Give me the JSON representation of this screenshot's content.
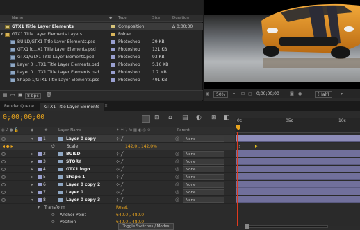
{
  "project": {
    "headers": {
      "name": "Name",
      "type": "Type",
      "size": "Size",
      "duration": "Duration"
    },
    "items": [
      {
        "name": "GTX1 Title Layer Elements",
        "type": "Composition",
        "size": "",
        "duration": "Δ 0;00;30",
        "label_color": "#d6c37a",
        "icon": "composition-icon",
        "selected": true
      },
      {
        "name": "GTX1 Title Layer Elements Layers",
        "type": "Folder",
        "size": "",
        "duration": "",
        "label_color": "#d8b55c",
        "icon": "folder-icon"
      },
      {
        "name": "BUILD/GTX1 Title Layer Elements.psd",
        "type": "Photoshop",
        "size": "29 KB",
        "duration": "",
        "label_color": "#9aa0d0",
        "icon": "photoshop-file-icon"
      },
      {
        "name": "GTX1 lo...X1 Title Layer Elements.psd",
        "type": "Photoshop",
        "size": "121 KB",
        "duration": "",
        "label_color": "#9aa0d0",
        "icon": "photoshop-file-icon"
      },
      {
        "name": "GTX1/GTX1 Title Layer Elements.psd",
        "type": "Photoshop",
        "size": "93 KB",
        "duration": "",
        "label_color": "#9aa0d0",
        "icon": "photoshop-file-icon"
      },
      {
        "name": "Layer 0 ...TX1 Title Layer Elements.psd",
        "type": "Photoshop",
        "size": "5.16 KB",
        "duration": "",
        "label_color": "#9aa0d0",
        "icon": "photoshop-file-icon"
      },
      {
        "name": "Layer 0 ...TX1 Title Layer Elements.psd",
        "type": "Photoshop",
        "size": "1.7 MB",
        "duration": "",
        "label_color": "#9aa0d0",
        "icon": "photoshop-file-icon"
      },
      {
        "name": "Shape 1/GTX1 Title Layer Elements.psd",
        "type": "Photoshop",
        "size": "491 KB",
        "duration": "",
        "label_color": "#9aa0d0",
        "icon": "photoshop-file-icon"
      }
    ],
    "bpc": "8 bpc"
  },
  "viewer": {
    "zoom": "50%",
    "timecode": "0;00;00;00",
    "quality": "(Half)"
  },
  "tabs": [
    {
      "label": "Render Queue",
      "active": false
    },
    {
      "label": "GTX1 Title Layer Elements",
      "active": true
    }
  ],
  "timeline": {
    "timecode": "0;00;00;00",
    "headers": {
      "num": "#",
      "layer_name": "Layer Name",
      "parent": "Parent"
    },
    "ruler": [
      "0s",
      "05s",
      "10s"
    ],
    "layers": [
      {
        "num": "1",
        "name": "Layer 0 copy",
        "label_color": "#9aa0d0",
        "parent": "None",
        "selected": true
      },
      {
        "num": "2",
        "name": "BUILD",
        "label_color": "#9aa0d0",
        "parent": "None"
      },
      {
        "num": "3",
        "name": "STORY",
        "label_color": "#9aa0d0",
        "parent": "None"
      },
      {
        "num": "4",
        "name": "GTX1 logo",
        "label_color": "#9aa0d0",
        "parent": "None"
      },
      {
        "num": "5",
        "name": "Shape 1",
        "label_color": "#9aa0d0",
        "parent": "None"
      },
      {
        "num": "6",
        "name": "Layer 0 copy 2",
        "label_color": "#9aa0d0",
        "parent": "None"
      },
      {
        "num": "7",
        "name": "Layer 0",
        "label_color": "#9aa0d0",
        "parent": "None"
      },
      {
        "num": "8",
        "name": "Layer 0 copy 3",
        "label_color": "#9aa0d0",
        "parent": "None"
      }
    ],
    "scale": {
      "label": "Scale",
      "value": "142.0 , 142.0%"
    },
    "transform": {
      "label": "Transform",
      "reset": "Reset"
    },
    "anchor_point": {
      "label": "Anchor Point",
      "value": "640.0 , 480.0"
    },
    "position": {
      "label": "Position",
      "value": "640.0 , 480.0"
    },
    "toggle": "Toggle Switches / Modes"
  }
}
